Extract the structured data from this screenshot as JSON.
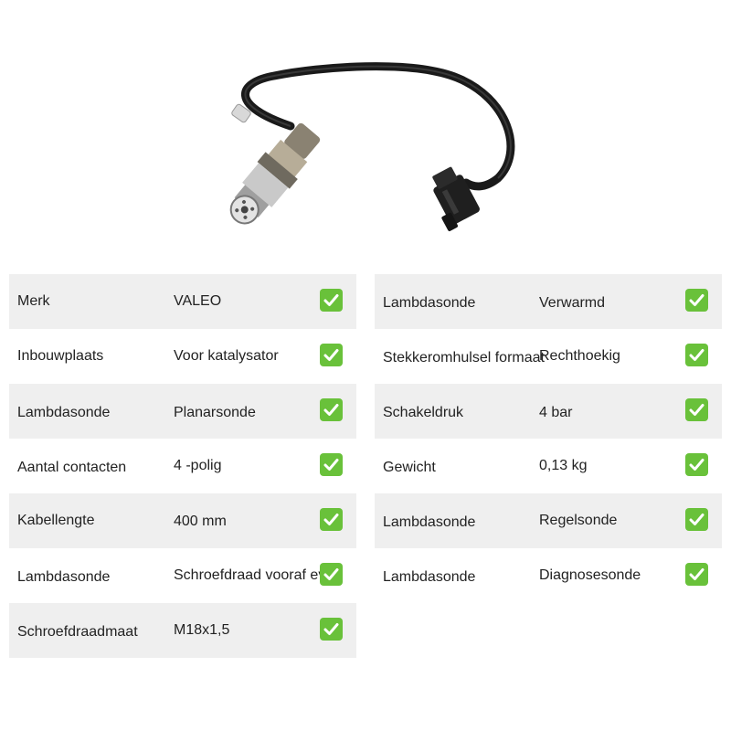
{
  "product": {
    "image_icon": "lambda-oxygen-sensor-with-cable-and-connector"
  },
  "specs_left": [
    {
      "label": "Merk",
      "value": "VALEO"
    },
    {
      "label": "Inbouwplaats",
      "value": "Voor katalysator"
    },
    {
      "label": "Lambdasonde",
      "value": "Planarsonde"
    },
    {
      "label": "Aantal contacten",
      "value": "4 -polig"
    },
    {
      "label": "Kabellengte",
      "value": "400 mm"
    },
    {
      "label": "Lambdasonde",
      "value": "Schroefdraad vooraf  ev"
    },
    {
      "label": "Schroefdraadmaat",
      "value": "M18x1,5"
    }
  ],
  "specs_right": [
    {
      "label": "Lambdasonde",
      "value": "Verwarmd"
    },
    {
      "label": "Stekkeromhulsel formaat",
      "value": "Rechthoekig"
    },
    {
      "label": "Schakeldruk",
      "value": "4 bar"
    },
    {
      "label": "Gewicht",
      "value": "0,13 kg"
    },
    {
      "label": "Lambdasonde",
      "value": "Regelsonde"
    },
    {
      "label": "Lambdasonde",
      "value": "Diagnosesonde"
    }
  ],
  "colors": {
    "row_shade": "#efefef",
    "check_green": "#69c13a",
    "text": "#222222"
  },
  "icons": {
    "row_status": "check-mark-icon"
  }
}
